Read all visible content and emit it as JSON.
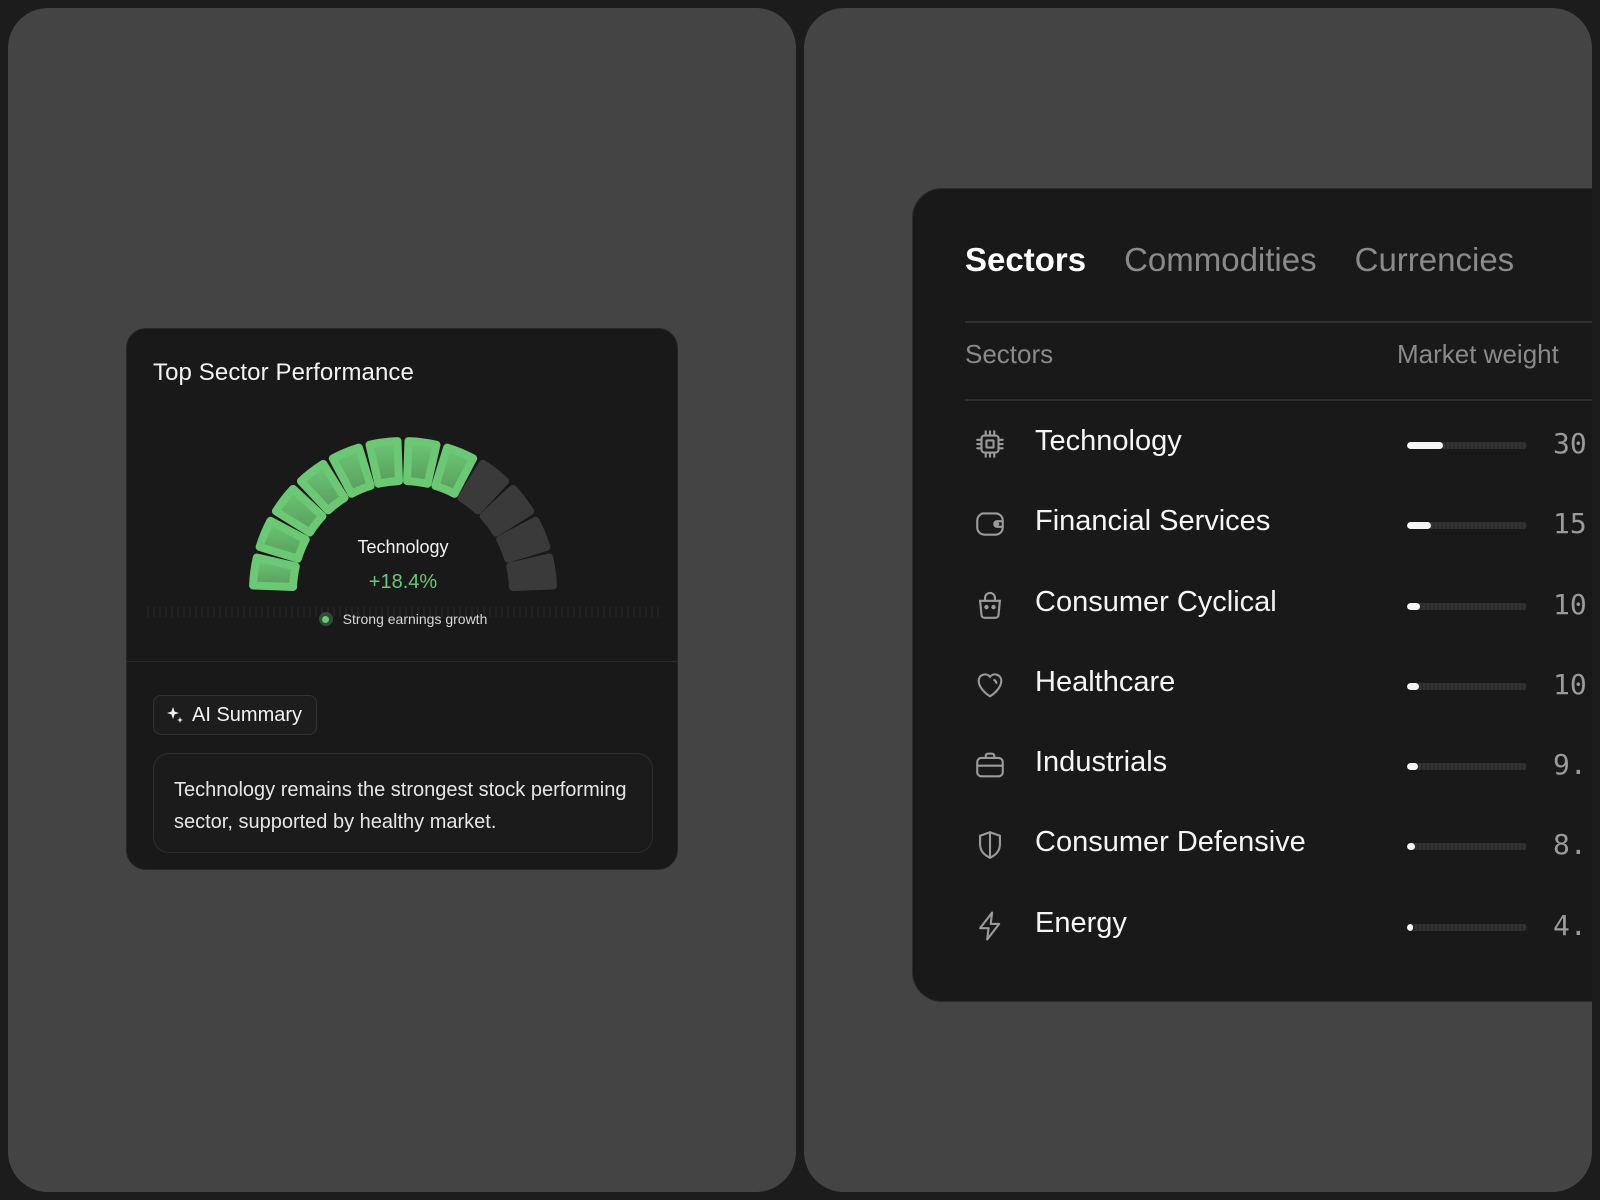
{
  "perf_card": {
    "title": "Top Sector Performance",
    "gauge": {
      "sector": "Technology",
      "change": "+18.4%",
      "note": "Strong earnings growth",
      "segments_total": 12,
      "segments_active": 8,
      "active_color": "#6cc874",
      "inactive_color": "#3a3a3a"
    },
    "ai_chip_label": "AI Summary",
    "summary": "Technology remains the strongest stock performing sector, supported by healthy market."
  },
  "market_card": {
    "tabs": [
      {
        "label": "Sectors",
        "active": true
      },
      {
        "label": "Commodities",
        "active": false
      },
      {
        "label": "Currencies",
        "active": false
      }
    ],
    "columns": {
      "sector": "Sectors",
      "weight": "Market weight"
    },
    "rows": [
      {
        "name": "Technology",
        "icon": "chip-icon",
        "value_visible": "30",
        "fill_fraction": 0.3
      },
      {
        "name": "Financial Services",
        "icon": "wallet-icon",
        "value_visible": "15",
        "fill_fraction": 0.2
      },
      {
        "name": "Consumer Cyclical",
        "icon": "shopping-bag-icon",
        "value_visible": "10",
        "fill_fraction": 0.11
      },
      {
        "name": "Healthcare",
        "icon": "heart-icon",
        "value_visible": "10",
        "fill_fraction": 0.1
      },
      {
        "name": "Industrials",
        "icon": "briefcase-icon",
        "value_visible": "9.",
        "fill_fraction": 0.09
      },
      {
        "name": "Consumer Defensive",
        "icon": "shield-icon",
        "value_visible": "8.",
        "fill_fraction": 0.07
      },
      {
        "name": "Energy",
        "icon": "lightning-icon",
        "value_visible": "4.",
        "fill_fraction": 0.04
      }
    ],
    "colors": {
      "accent_fill": "#f5f5f5",
      "muted_text": "#8a8a8a"
    }
  }
}
